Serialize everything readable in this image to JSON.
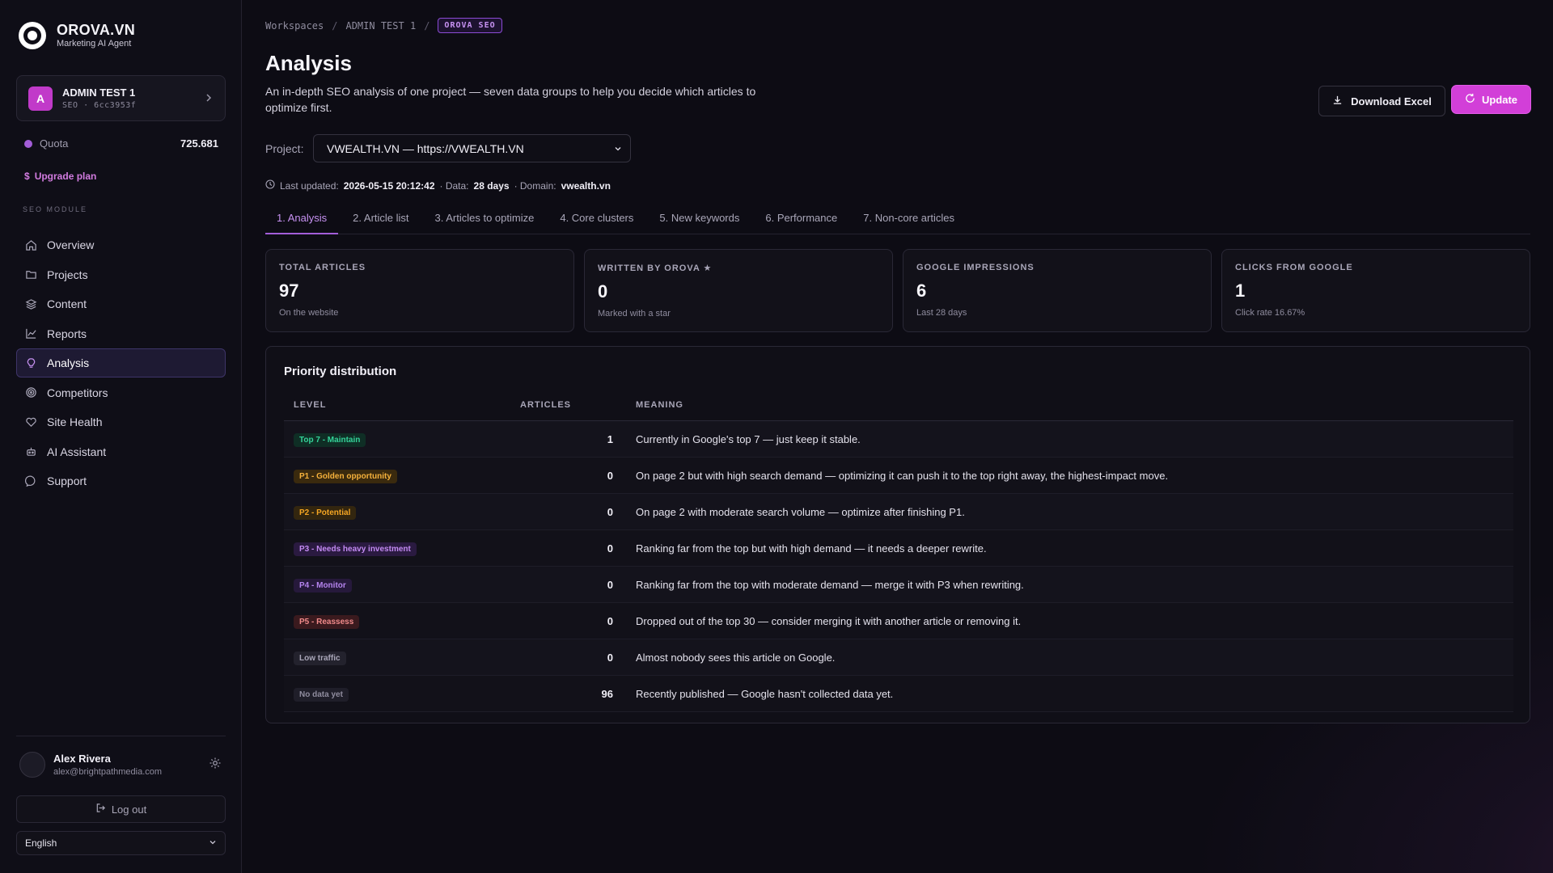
{
  "brand": {
    "name": "OROVA.VN",
    "tagline": "Marketing AI Agent"
  },
  "workspace": {
    "initial": "A",
    "name": "ADMIN TEST 1",
    "meta": "SEO · 6cc3953f"
  },
  "quota": {
    "label": "Quota",
    "value": "725.681"
  },
  "upgrade_label": "Upgrade plan",
  "section_label": "SEO MODULE",
  "nav": [
    {
      "label": "Overview",
      "icon": "home-icon"
    },
    {
      "label": "Projects",
      "icon": "folder-icon"
    },
    {
      "label": "Content",
      "icon": "layers-icon"
    },
    {
      "label": "Reports",
      "icon": "chart-line-icon"
    },
    {
      "label": "Analysis",
      "icon": "lightbulb-icon",
      "active": true
    },
    {
      "label": "Competitors",
      "icon": "target-icon"
    },
    {
      "label": "Site Health",
      "icon": "heart-icon"
    },
    {
      "label": "AI Assistant",
      "icon": "robot-icon"
    },
    {
      "label": "Support",
      "icon": "chat-icon"
    }
  ],
  "user": {
    "name": "Alex Rivera",
    "email": "alex@brightpathmedia.com"
  },
  "logout_label": "Log out",
  "language": "English",
  "breadcrumb": {
    "item1": "Workspaces",
    "item2": "ADMIN TEST 1",
    "badge": "OROVA SEO"
  },
  "page": {
    "title": "Analysis",
    "description": "An in-depth SEO analysis of one project — seven data groups to help you decide which articles to optimize first."
  },
  "actions": {
    "download": "Download Excel",
    "update": "Update"
  },
  "project": {
    "label": "Project:",
    "value": "VWEALTH.VN — https://VWEALTH.VN"
  },
  "meta": {
    "updated_label": "Last updated:",
    "updated_value": "2026-05-15 20:12:42",
    "data_label": "· Data:",
    "data_value": "28 days",
    "domain_label": "· Domain:",
    "domain_value": "vwealth.vn"
  },
  "tabs": [
    "1. Analysis",
    "2. Article list",
    "3. Articles to optimize",
    "4. Core clusters",
    "5. New keywords",
    "6. Performance",
    "7. Non-core articles"
  ],
  "cards": [
    {
      "label": "TOTAL ARTICLES",
      "value": "97",
      "sub": "On the website"
    },
    {
      "label": "WRITTEN BY OROVA ★",
      "value": "0",
      "sub": "Marked with a star"
    },
    {
      "label": "GOOGLE IMPRESSIONS",
      "value": "6",
      "sub": "Last 28 days"
    },
    {
      "label": "CLICKS FROM GOOGLE",
      "value": "1",
      "sub": "Click rate 16.67%"
    }
  ],
  "priority": {
    "title": "Priority distribution",
    "headers": {
      "level": "LEVEL",
      "articles": "ARTICLES",
      "meaning": "MEANING"
    },
    "rows": [
      {
        "level": "Top 7 - Maintain",
        "count": "1",
        "meaning": "Currently in Google's top 7 — just keep it stable.",
        "fg": "#34d399",
        "bg": "#0f2e25"
      },
      {
        "level": "P1 - Golden opportunity",
        "count": "0",
        "meaning": "On page 2 but with high search demand — optimizing it can push it to the top right away, the highest-impact move.",
        "fg": "#f5b13b",
        "bg": "#3a2a0e"
      },
      {
        "level": "P2 - Potential",
        "count": "0",
        "meaning": "On page 2 with moderate search volume — optimize after finishing P1.",
        "fg": "#f5a623",
        "bg": "#33260f"
      },
      {
        "level": "P3 - Needs heavy investment",
        "count": "0",
        "meaning": "Ranking far from the top but with high demand — it needs a deeper rewrite.",
        "fg": "#c38af2",
        "bg": "#2a1a40"
      },
      {
        "level": "P4 - Monitor",
        "count": "0",
        "meaning": "Ranking far from the top with moderate demand — merge it with P3 when rewriting.",
        "fg": "#b584ee",
        "bg": "#26193b"
      },
      {
        "level": "P5 - Reassess",
        "count": "0",
        "meaning": "Dropped out of the top 30 — consider merging it with another article or removing it.",
        "fg": "#f08a8a",
        "bg": "#3a1a1e"
      },
      {
        "level": "Low traffic",
        "count": "0",
        "meaning": "Almost nobody sees this article on Google.",
        "fg": "#a9a6b8",
        "bg": "#23222d"
      },
      {
        "level": "No data yet",
        "count": "96",
        "meaning": "Recently published — Google hasn't collected data yet.",
        "fg": "#8f8c9e",
        "bg": "#1f1e29"
      }
    ]
  }
}
